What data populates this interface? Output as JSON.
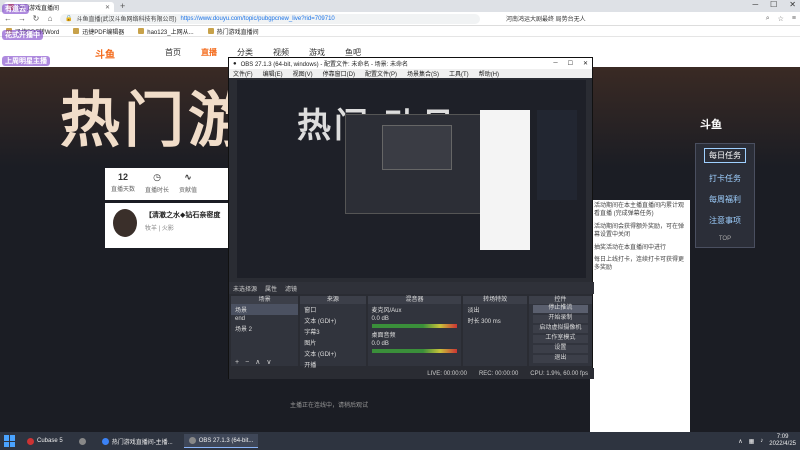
{
  "browser": {
    "tab_title": "热门游戏直播间",
    "url_org": "斗鱼直播(武汉斗鱼网络科技有限公司)",
    "url": "https://www.douyu.com/topic/pubgpcnew_live?rid=709710",
    "hot_news": "河南鸿运大剧最终 局势台无人",
    "bookmarks": [
      "迅捷PDF转Word",
      "迅捷PDF编辑器",
      "hao123_上网从...",
      "热门游戏直播间"
    ]
  },
  "douyu": {
    "nav": [
      "首页",
      "直播",
      "分类",
      "视频",
      "游戏",
      "鱼吧"
    ],
    "active_nav": "直播",
    "banner_text": "热门游戏直播月",
    "info": {
      "count": "12",
      "labels": [
        "直播天数",
        "直播时长",
        "贡献值"
      ]
    },
    "anchor_name": "【清澈之水◆钻石亲密度",
    "anchor_sub": "牧羊 | 火影",
    "right_logo": "斗鱼",
    "right_panel": [
      "每日任务",
      "打卡任务",
      "每周福利",
      "注意事项",
      "TOP"
    ],
    "right_active": "每日任务",
    "chat": [
      "活动期间在本主播直播间内累计观看直播 (完成弹幕任务)",
      "活动期间会获得额外奖励，可在弹幕设置中关闭",
      "抽奖活动在本直播间中进行",
      "每日上线打卡，连续打卡可获得更多奖励"
    ]
  },
  "obs": {
    "title": "OBS 27.1.3 (64-bit, windows) - 配置文件: 未命名 - 场景: 未命名",
    "menu": [
      "文件(F)",
      "编辑(E)",
      "视图(V)",
      "停靠窗口(D)",
      "配置文件(P)",
      "场景集合(S)",
      "工具(T)",
      "帮助(H)"
    ],
    "preview_text": "热门 动月",
    "scene_header": [
      "未选择源",
      "属性",
      "滤镜"
    ],
    "docks": {
      "scenes": {
        "title": "场景",
        "items": [
          "场景",
          "end",
          "场景 2"
        ]
      },
      "sources": {
        "title": "来源",
        "items": [
          "窗口",
          "文本 (GDI+)",
          "字幕3",
          "图片",
          "文本 (GDI+)",
          "开播"
        ]
      },
      "mixer": {
        "title": "混音器",
        "items": [
          "麦克风/Aux",
          "桌面音频"
        ],
        "levels": [
          "0.0 dB",
          "0.0 dB"
        ]
      },
      "transitions": {
        "title": "转场特效",
        "type": "淡出",
        "duration_label": "时长",
        "duration": "300 ms"
      },
      "controls": {
        "title": "控件",
        "buttons": [
          "停止推流",
          "开始录制",
          "启动虚拟摄像机",
          "工作室模式",
          "设置",
          "退出"
        ]
      }
    },
    "status": {
      "live": "LIVE: 00:00:00",
      "rec": "REC: 00:00:00",
      "cpu": "CPU: 1.9%, 60.00 fps"
    }
  },
  "desktop_msg": "主播正在连线中，请稍后观试",
  "taskbar": {
    "items": [
      "Cubase 5",
      "热门游戏直播间-主播...",
      "OBS 27.1.3 (64-bit..."
    ],
    "active_index": 2,
    "time": "7:09",
    "date": "2022/4/25"
  },
  "overlay": [
    "有道云",
    "花式开播中",
    "上周明星主播"
  ]
}
